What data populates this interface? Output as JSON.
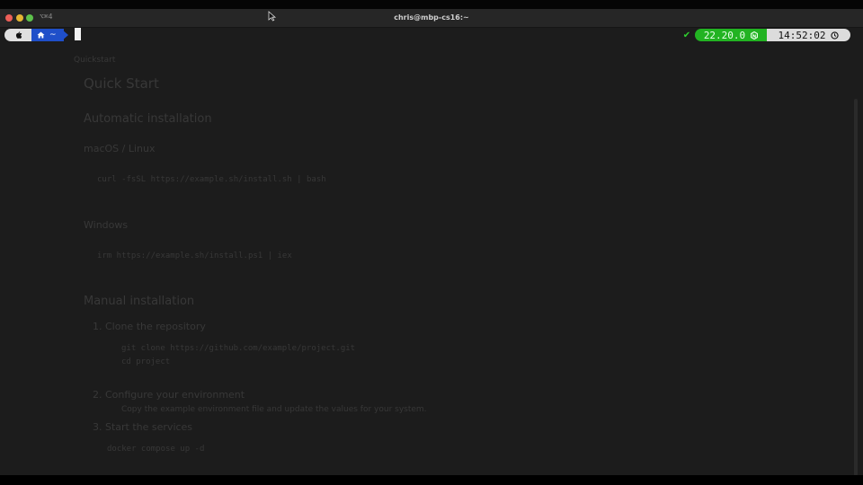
{
  "window": {
    "shortcut": "⌥⌘4",
    "title": "chris@mbp-cs16:~"
  },
  "prompt": {
    "apple_icon": "apple-logo",
    "home_icon": "home-icon",
    "dir": "~"
  },
  "status": {
    "check": "✔",
    "node_version": "22.20.0",
    "node_icon": "node-icon",
    "time": "14:52:02",
    "clock_icon": "clock-icon"
  },
  "ghost_doc": {
    "breadcrumb": "Quickstart",
    "title": "Quick Start",
    "h2_auto": "Automatic installation",
    "h3_mac": "macOS / Linux",
    "cmd_mac": "curl -fsSL https://example.sh/install.sh | bash",
    "h3_win": "Windows",
    "cmd_win": "irm https://example.sh/install.ps1 | iex",
    "h2_manual": "Manual installation",
    "step1": "1. Clone the repository",
    "step1_a": "git clone https://github.com/example/project.git",
    "step1_b": "cd project",
    "step2": "2. Configure your environment",
    "step2_a": "Copy the example environment file and update the values for your system.",
    "step3": "3. Start the services",
    "step3_a": "docker compose up -d"
  },
  "colors": {
    "terminal_bg": "#1c1c1c",
    "dir_segment": "#1f4fc9",
    "node_segment": "#22b322",
    "time_segment": "#dcdcdc"
  }
}
